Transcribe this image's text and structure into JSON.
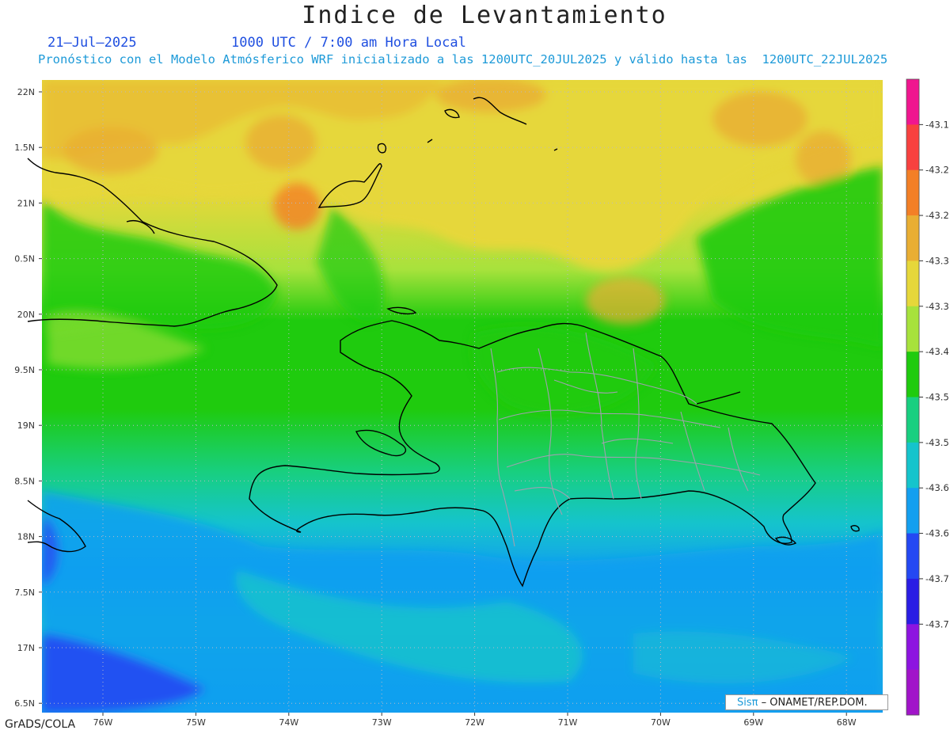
{
  "header": {
    "title": "Indice de Levantamiento",
    "date": "21–Jul–2025",
    "valid_time": "1000 UTC / 7:00 am Hora Local",
    "description": "Pronóstico con el Modelo Atmósferico WRF inicializado a las 1200UTC_20JUL2025 y válido hasta las  1200UTC_22JUL2025"
  },
  "map": {
    "lon_labels": [
      "76W",
      "75W",
      "74W",
      "73W",
      "72W",
      "71W",
      "70W",
      "69W",
      "68W"
    ],
    "lat_labels": [
      "22N",
      "1.5N",
      "21N",
      "0.5N",
      "20N",
      "9.5N",
      "19N",
      "8.5N",
      "18N",
      "7.5N",
      "17N",
      "6.5N"
    ]
  },
  "colorbar": {
    "labels": [
      "-43.1",
      "-43.2",
      "-43.2",
      "-43.3",
      "-43.3",
      "-43.4",
      "-43.5",
      "-43.5",
      "-43.6",
      "-43.6",
      "-43.7",
      "-43.7"
    ],
    "colors": [
      "#f0168f",
      "#f8413f",
      "#f37f26",
      "#e9ae33",
      "#e6d73a",
      "#a7e23c",
      "#1fcb0e",
      "#18cf80",
      "#15c4cc",
      "#139ff0",
      "#2448f3",
      "#2a1de4",
      "#8d14e0",
      "#a114c9"
    ]
  },
  "footer": {
    "software": "GrADS/COLA",
    "credit_sis": "Sisπ",
    "credit_org": "– ONAMET/REP.DOM."
  }
}
